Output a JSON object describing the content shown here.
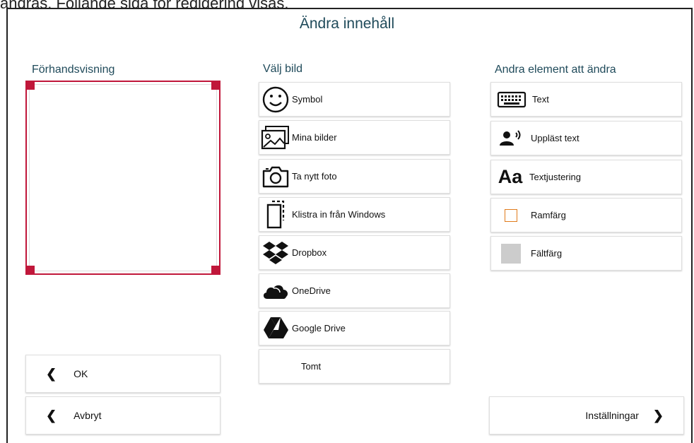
{
  "caption": "ändras. Följande sida för redigering visas.",
  "title": "Ändra innehåll",
  "headers": {
    "preview": "Förhandsvisning",
    "choose_image": "Välj bild",
    "other_elements": "Andra element att ändra"
  },
  "image_options": [
    {
      "label": "Symbol",
      "icon": "smiley-icon"
    },
    {
      "label": "Mina bilder",
      "icon": "pictures-icon"
    },
    {
      "label": "Ta nytt foto",
      "icon": "camera-icon"
    },
    {
      "label": "Klistra in från Windows",
      "icon": "paste-icon"
    },
    {
      "label": "Dropbox",
      "icon": "dropbox-icon"
    },
    {
      "label": "OneDrive",
      "icon": "onedrive-icon"
    },
    {
      "label": "Google Drive",
      "icon": "google-drive-icon"
    },
    {
      "label": "Tomt",
      "icon": ""
    }
  ],
  "element_options": [
    {
      "label": "Text",
      "icon": "keyboard-icon"
    },
    {
      "label": "Uppläst text",
      "icon": "speaker-person-icon"
    },
    {
      "label": "Textjustering",
      "icon": "font-aa-icon",
      "icon_text": "Aa"
    },
    {
      "label": "Ramfärg",
      "icon": "frame-color-swatch",
      "color": "#e07b1c"
    },
    {
      "label": "Fältfärg",
      "icon": "fill-color-swatch",
      "color": "#cccccc"
    }
  ],
  "buttons": {
    "ok": "OK",
    "cancel": "Avbryt",
    "settings": "Inställningar"
  },
  "colors": {
    "accent": "#c0173a",
    "heading": "#1f4a5a"
  }
}
